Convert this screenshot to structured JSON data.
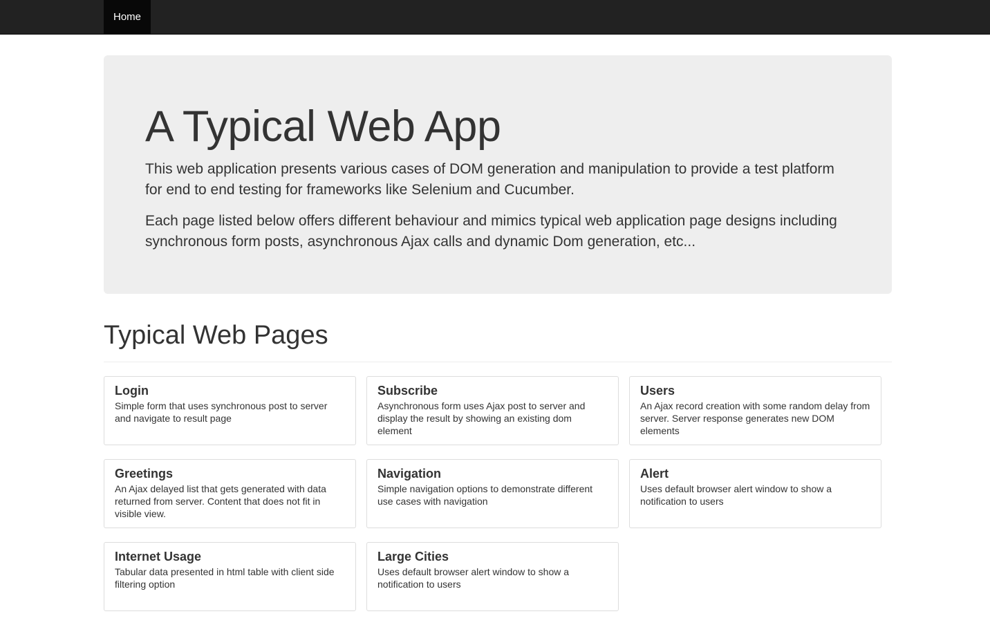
{
  "navbar": {
    "items": [
      {
        "label": "Home",
        "active": true
      }
    ]
  },
  "jumbotron": {
    "title": "A Typical Web App",
    "paragraphs": [
      "This web application presents various cases of DOM generation and manipulation to provide a test platform for end to end testing for frameworks like Selenium and Cucumber.",
      "Each page listed below offers different behaviour and mimics typical web application page designs including synchronous form posts, asynchronous Ajax calls and dynamic Dom generation, etc..."
    ]
  },
  "section": {
    "title": "Typical Web Pages"
  },
  "cards": [
    {
      "title": "Login",
      "description": "Simple form that uses synchronous post to server and navigate to result page"
    },
    {
      "title": "Subscribe",
      "description": "Asynchronous form uses Ajax post to server and display the result by showing an existing dom element"
    },
    {
      "title": "Users",
      "description": "An Ajax record creation with some random delay from server. Server response generates new DOM elements"
    },
    {
      "title": "Greetings",
      "description": "An Ajax delayed list that gets generated with data returned from server. Content that does not fit in visible view."
    },
    {
      "title": "Navigation",
      "description": "Simple navigation options to demonstrate different use cases with navigation"
    },
    {
      "title": "Alert",
      "description": "Uses default browser alert window to show a notification to users"
    },
    {
      "title": "Internet Usage",
      "description": "Tabular data presented in html table with client side filtering option"
    },
    {
      "title": "Large Cities",
      "description": "Uses default browser alert window to show a notification to users"
    }
  ],
  "colors": {
    "navbar_bg": "#222222",
    "nav_active_bg": "#080808",
    "jumbotron_bg": "#eeeeee",
    "card_border": "#dddddd",
    "text": "#333333"
  }
}
